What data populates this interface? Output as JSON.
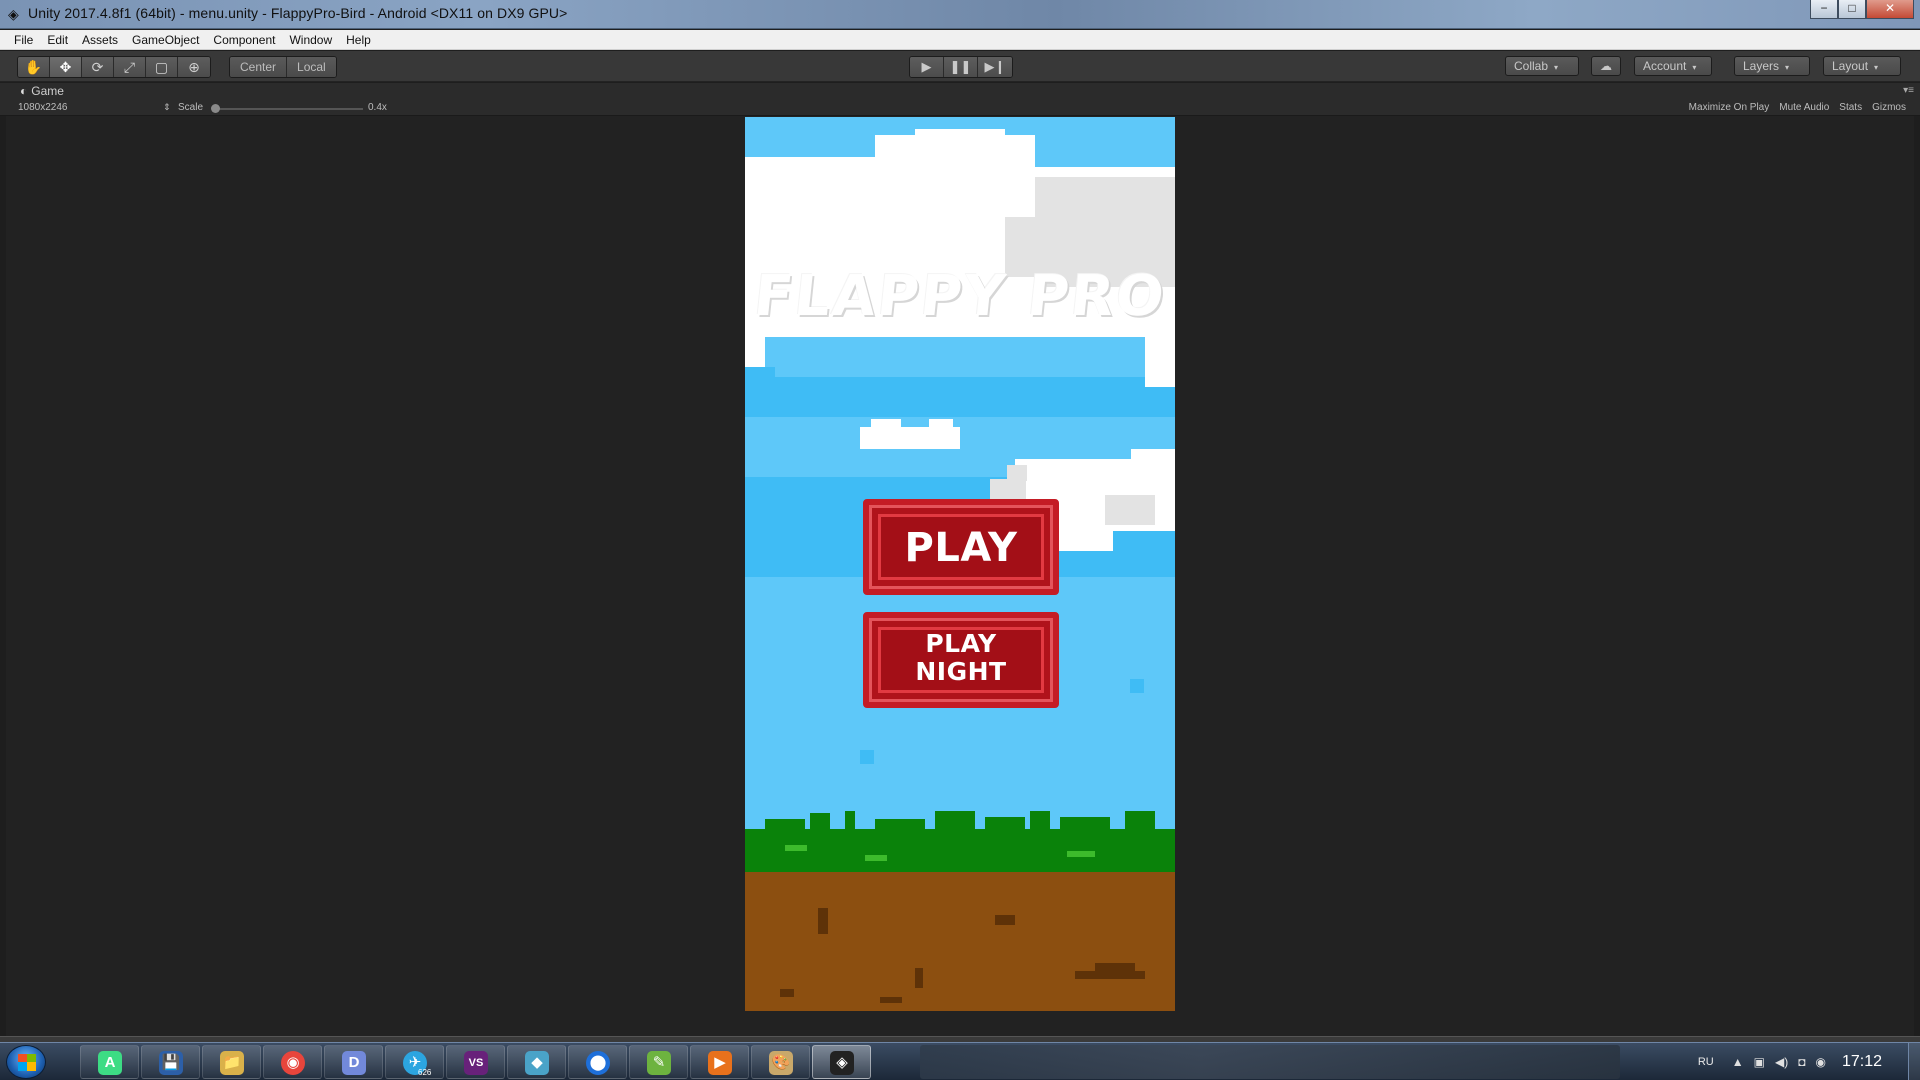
{
  "window": {
    "title": "Unity 2017.4.8f1 (64bit) - menu.unity - FlappyPro-Bird - Android <DX11 on DX9 GPU>",
    "minimize": "−",
    "maximize": "□",
    "close": "✕"
  },
  "menubar": {
    "items": [
      "File",
      "Edit",
      "Assets",
      "GameObject",
      "Component",
      "Window",
      "Help"
    ]
  },
  "toolbar": {
    "tools": [
      {
        "name": "hand-tool",
        "glyph": "✋"
      },
      {
        "name": "move-tool",
        "glyph": "✥"
      },
      {
        "name": "rotate-tool",
        "glyph": "⟳"
      },
      {
        "name": "scale-tool",
        "glyph": "⤢"
      },
      {
        "name": "rect-tool",
        "glyph": "▢"
      },
      {
        "name": "transform-tool",
        "glyph": "⊕"
      }
    ],
    "pivot": "Center",
    "pivot_rotation": "Local",
    "play": "▶",
    "pause": "❚❚",
    "step": "▶❙",
    "collab": "Collab",
    "account": "Account",
    "layers": "Layers",
    "layout": "Layout",
    "caret": "▾"
  },
  "game_view": {
    "tab_label": "Game",
    "resolution": "1080x2246",
    "scale_label": "Scale",
    "scale_value": "0.4x",
    "options": [
      "Maximize On Play",
      "Mute Audio",
      "Stats",
      "Gizmos"
    ]
  },
  "game": {
    "title": "FLAPPY PRO",
    "play_button": "PLAY",
    "play_night_button": "PLAY\nNIGHT",
    "colors": {
      "sky": "#5ec8f9",
      "sky_band": "#3fbcf5",
      "grass": "#0a820a",
      "dirt": "#8c4f10",
      "button": "#c41c25"
    }
  },
  "taskbar": {
    "apps": [
      {
        "name": "android-studio",
        "color": "#3ddc84",
        "glyph": "A"
      },
      {
        "name": "floppy-save",
        "color": "#2c5fa8",
        "glyph": "💾"
      },
      {
        "name": "file-explorer",
        "color": "#d9b14a",
        "glyph": "📁"
      },
      {
        "name": "chrome",
        "color": "#e8453c",
        "glyph": "◉"
      },
      {
        "name": "discord",
        "color": "#7289da",
        "glyph": "D"
      },
      {
        "name": "telegram",
        "color": "#2ca5e0",
        "glyph": "✈"
      },
      {
        "name": "visual-studio",
        "color": "#68217a",
        "glyph": "VS"
      },
      {
        "name": "eraser-app",
        "color": "#4aa3c8",
        "glyph": "◆"
      },
      {
        "name": "maps-pin",
        "color": "#1e6fd9",
        "glyph": "⬤"
      },
      {
        "name": "script-editor",
        "color": "#6db33f",
        "glyph": "✎"
      },
      {
        "name": "media-player",
        "color": "#e8711c",
        "glyph": "▶"
      },
      {
        "name": "paint",
        "color": "#c9a86a",
        "glyph": "🎨"
      },
      {
        "name": "unity",
        "color": "#222222",
        "glyph": "◈"
      }
    ],
    "telegram_count": "626",
    "language": "RU",
    "clock": "17:12"
  }
}
